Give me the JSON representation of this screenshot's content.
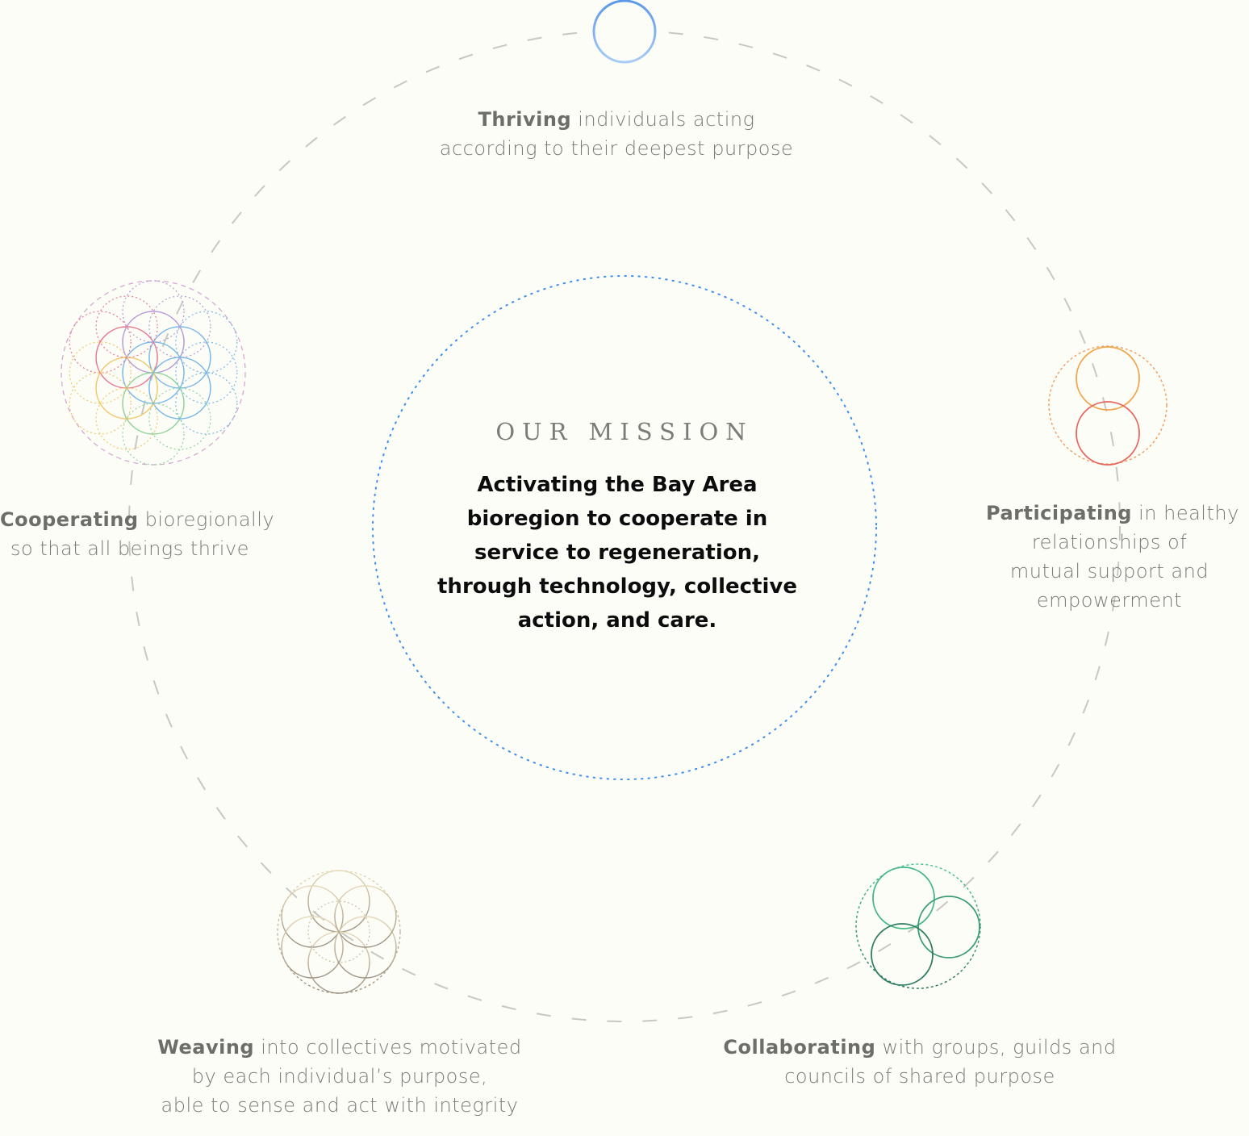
{
  "mission": {
    "heading": "OUR MISSION",
    "statement": "Activating the Bay Area bioregion to cooperate in service to regeneration, through technology, collective action, and care."
  },
  "nodes": {
    "thriving": {
      "lead": "Thriving",
      "line1_rest": " individuals acting",
      "line2": "according to their deepest purpose",
      "icon": "thriving-circle-icon",
      "color": "#5b97e8"
    },
    "participating": {
      "lead": "Participating",
      "line1_rest": " in healthy",
      "line2": "relationships of",
      "line3": "mutual support and",
      "line4": "empowerment",
      "icon": "two-circles-icon",
      "colors": [
        "#f2a54a",
        "#e8665c"
      ]
    },
    "collaborating": {
      "lead": "Collaborating",
      "line1_rest": " with groups, guilds and",
      "line2": "councils of shared purpose",
      "icon": "three-circles-icon",
      "color": "#3aa87a"
    },
    "weaving": {
      "lead": "Weaving",
      "line1_rest": " into collectives motivated",
      "line2": "by each individual’s purpose,",
      "line3": "able to sense and act with integrity",
      "icon": "seed-of-life-icon",
      "color": "#b8a88a"
    },
    "cooperating": {
      "lead": "Cooperating",
      "line1_rest": " bioregionally",
      "line2": "so that all beings thrive",
      "icon": "flower-of-life-icon",
      "colors": [
        "#f0c86a",
        "#8fd49a",
        "#7ab8e8",
        "#b89ad8",
        "#e87a8f"
      ]
    }
  },
  "palette": {
    "orbit": "#c8c8c2",
    "mission_ring": "#3d8ef0",
    "background": "#fdfdf8"
  }
}
